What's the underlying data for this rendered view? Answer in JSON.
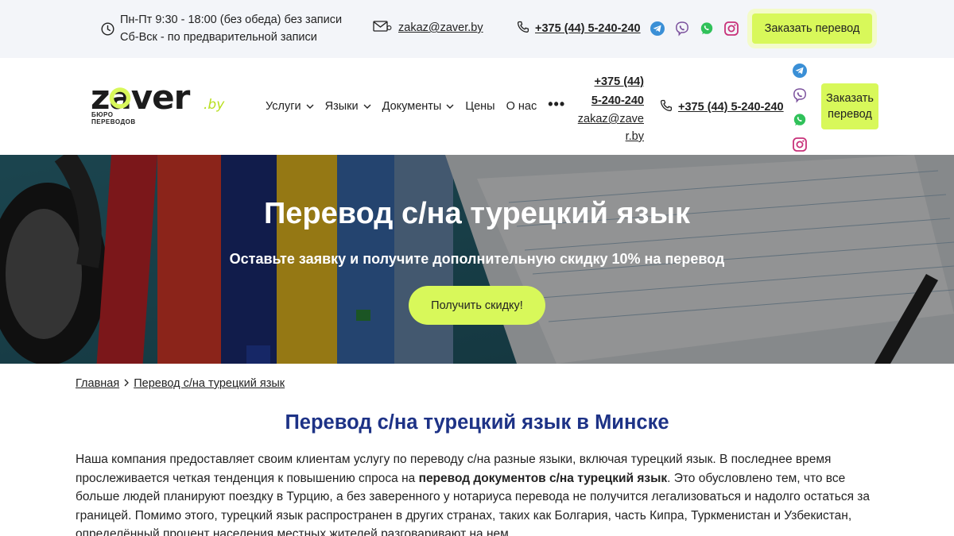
{
  "topbar": {
    "hours_line1": "Пн-Пт 9:30 - 18:00 (без обеда) без записи",
    "hours_line2": "Сб-Вск - по предварительной записи",
    "email": "zakaz@zaver.by",
    "phone": "+375 (44) 5-240-240",
    "order_label": "Заказать перевод"
  },
  "header": {
    "logo_text": "zaver",
    "logo_domain": ".by",
    "logo_sub1": "бюро",
    "logo_sub2": "переводов",
    "nav": [
      {
        "label": "Услуги",
        "has_dropdown": true
      },
      {
        "label": "Языки",
        "has_dropdown": true
      },
      {
        "label": "Документы",
        "has_dropdown": true
      },
      {
        "label": "Цены",
        "has_dropdown": false
      },
      {
        "label": "О нас",
        "has_dropdown": false
      }
    ],
    "more_label": "•••",
    "contact_phone_line1": "+375 (44)",
    "contact_phone_line2": "5-240-240",
    "contact_email_line1": "zakaz@zave",
    "contact_email_line2": "r.by",
    "phone2": "+375 (44) 5-240-240",
    "order_line1": "Заказать",
    "order_line2": "перевод"
  },
  "socials": [
    "telegram-icon",
    "viber-icon",
    "whatsapp-icon",
    "instagram-icon"
  ],
  "hero": {
    "title": "Перевод с/на турецкий язык",
    "subtitle": "Оставьте заявку и получите дополнительную скидку 10% на перевод",
    "button_label": "Получить скидку!"
  },
  "breadcrumb": {
    "home": "Главная",
    "current": "Перевод с/на турецкий язык"
  },
  "content": {
    "title": "Перевод с/на турецкий язык в Минске",
    "p1_a": "Наша компания предоставляет своим клиентам услугу по переводу с/на разные языки, включая турецкий язык. В последнее время прослеживается четкая тенденция к повышению спроса на ",
    "p1_bold": "перевод документов с/на турецкий язык",
    "p1_b": ". Это обусловлено тем, что все больше людей планируют поездку в Турцию, а без заверенного у нотариуса перевода не получится легализоваться и надолго остаться за границей. Помимо этого, турецкий язык распространен в других странах, таких как Болгария, часть Кипра, Туркменистан и Узбекистан, определённый процент населения местных жителей разговаривают на нем."
  },
  "colors": {
    "accent": "#d8f85a",
    "title_blue": "#1d3286",
    "topbar_bg": "#f3f5f9"
  }
}
